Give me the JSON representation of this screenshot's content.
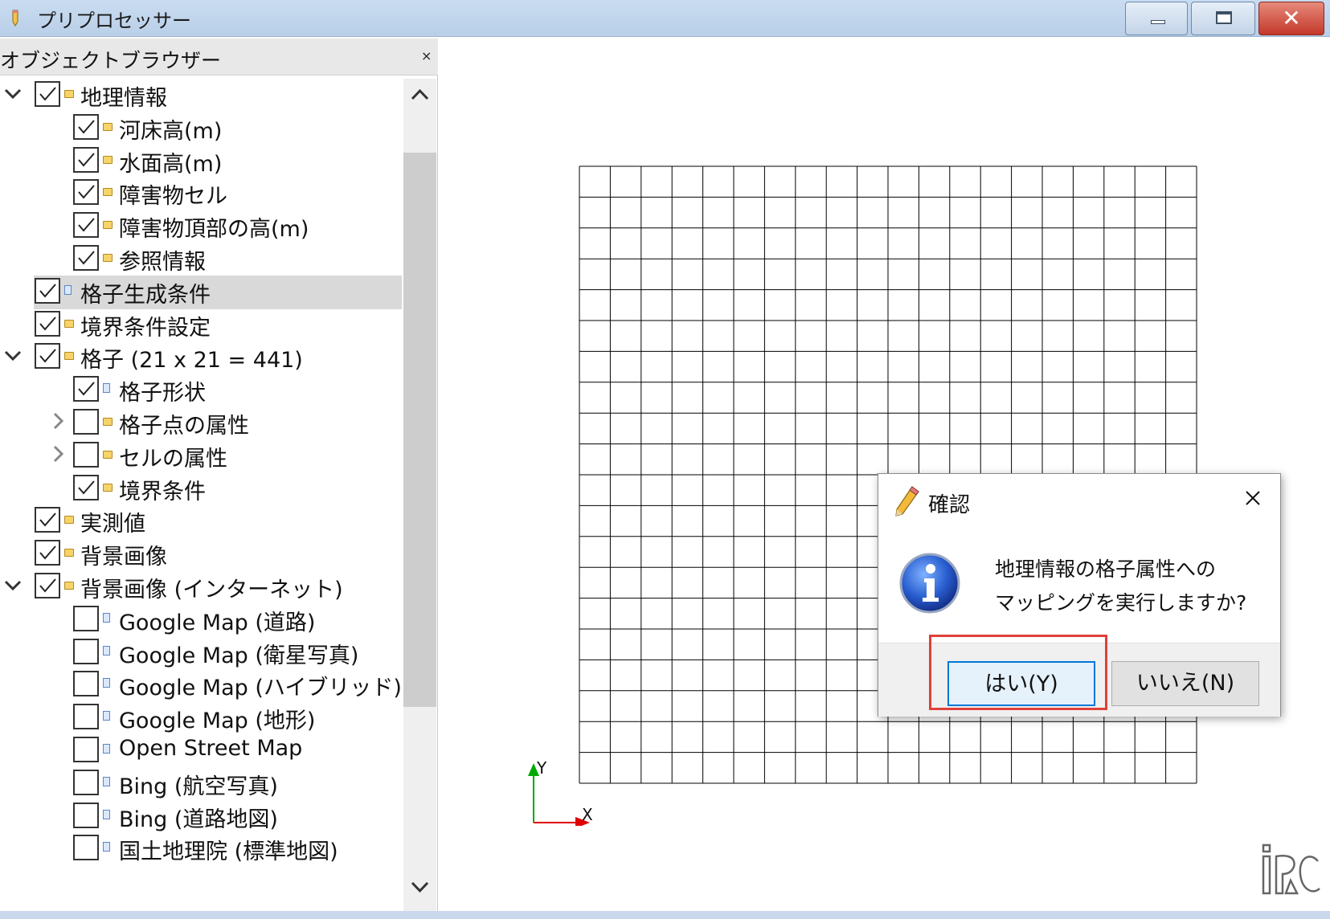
{
  "window": {
    "title": "プリプロセッサー",
    "controls": [
      "minimize-icon",
      "maximize-icon",
      "close-icon"
    ]
  },
  "object_browser": {
    "title": "オブジェクトブラウザー",
    "close_glyph": "×",
    "items": [
      {
        "label": "地理情報",
        "level": 0,
        "checked": true,
        "expander": "expanded",
        "icon": "folder-icon",
        "selected": false
      },
      {
        "label": "河床高(m)",
        "level": 1,
        "checked": true,
        "expander": "none",
        "icon": "folder-icon",
        "selected": false
      },
      {
        "label": "水面高(m)",
        "level": 1,
        "checked": true,
        "expander": "none",
        "icon": "folder-icon",
        "selected": false
      },
      {
        "label": "障害物セル",
        "level": 1,
        "checked": true,
        "expander": "none",
        "icon": "folder-icon",
        "selected": false
      },
      {
        "label": "障害物頂部の高(m)",
        "level": 1,
        "checked": true,
        "expander": "none",
        "icon": "folder-icon",
        "selected": false
      },
      {
        "label": "参照情報",
        "level": 1,
        "checked": true,
        "expander": "none",
        "icon": "folder-icon",
        "selected": false
      },
      {
        "label": "格子生成条件",
        "level": 0,
        "checked": true,
        "expander": "none",
        "icon": "document-icon",
        "selected": true
      },
      {
        "label": "境界条件設定",
        "level": 0,
        "checked": true,
        "expander": "none",
        "icon": "folder-icon",
        "selected": false
      },
      {
        "label": "格子 (21 x 21 = 441)",
        "level": 0,
        "checked": true,
        "expander": "expanded",
        "icon": "folder-icon",
        "selected": false
      },
      {
        "label": "格子形状",
        "level": 1,
        "checked": true,
        "expander": "none",
        "icon": "document-icon",
        "selected": false
      },
      {
        "label": "格子点の属性",
        "level": 1,
        "checked": false,
        "expander": "collapsed",
        "icon": "folder-icon",
        "selected": false
      },
      {
        "label": "セルの属性",
        "level": 1,
        "checked": false,
        "expander": "collapsed",
        "icon": "folder-icon",
        "selected": false
      },
      {
        "label": "境界条件",
        "level": 1,
        "checked": true,
        "expander": "none",
        "icon": "folder-icon",
        "selected": false
      },
      {
        "label": "実測値",
        "level": 0,
        "checked": true,
        "expander": "none",
        "icon": "folder-icon",
        "selected": false
      },
      {
        "label": "背景画像",
        "level": 0,
        "checked": true,
        "expander": "none",
        "icon": "folder-icon",
        "selected": false
      },
      {
        "label": "背景画像 (インターネット)",
        "level": 0,
        "checked": true,
        "expander": "expanded",
        "icon": "folder-icon",
        "selected": false
      },
      {
        "label": "Google Map (道路)",
        "level": 1,
        "checked": false,
        "expander": "none",
        "icon": "document-icon",
        "selected": false
      },
      {
        "label": "Google Map (衛星写真)",
        "level": 1,
        "checked": false,
        "expander": "none",
        "icon": "document-icon",
        "selected": false
      },
      {
        "label": "Google Map (ハイブリッド)",
        "level": 1,
        "checked": false,
        "expander": "none",
        "icon": "document-icon",
        "selected": false
      },
      {
        "label": "Google Map (地形)",
        "level": 1,
        "checked": false,
        "expander": "none",
        "icon": "document-icon",
        "selected": false
      },
      {
        "label": "Open Street Map",
        "level": 1,
        "checked": false,
        "expander": "none",
        "icon": "document-icon",
        "selected": false
      },
      {
        "label": "Bing (航空写真)",
        "level": 1,
        "checked": false,
        "expander": "none",
        "icon": "document-icon",
        "selected": false
      },
      {
        "label": "Bing (道路地図)",
        "level": 1,
        "checked": false,
        "expander": "none",
        "icon": "document-icon",
        "selected": false
      },
      {
        "label": "国土地理院 (標準地図)",
        "level": 1,
        "checked": false,
        "expander": "none",
        "icon": "document-icon",
        "selected": false
      }
    ]
  },
  "canvas": {
    "grid": {
      "i_points": 21,
      "j_points": 21
    },
    "axis_x_label": "X",
    "axis_y_label": "Y",
    "axis_x_color": "#e00000",
    "axis_y_color": "#00aa00",
    "logo": "iRIC"
  },
  "dialog": {
    "title": "確認",
    "message_line1": "地理情報の格子属性への",
    "message_line2": "マッピングを実行しますか?",
    "yes_label": "はい(Y)",
    "no_label": "いいえ(N)",
    "highlight_color": "#e0403a"
  }
}
